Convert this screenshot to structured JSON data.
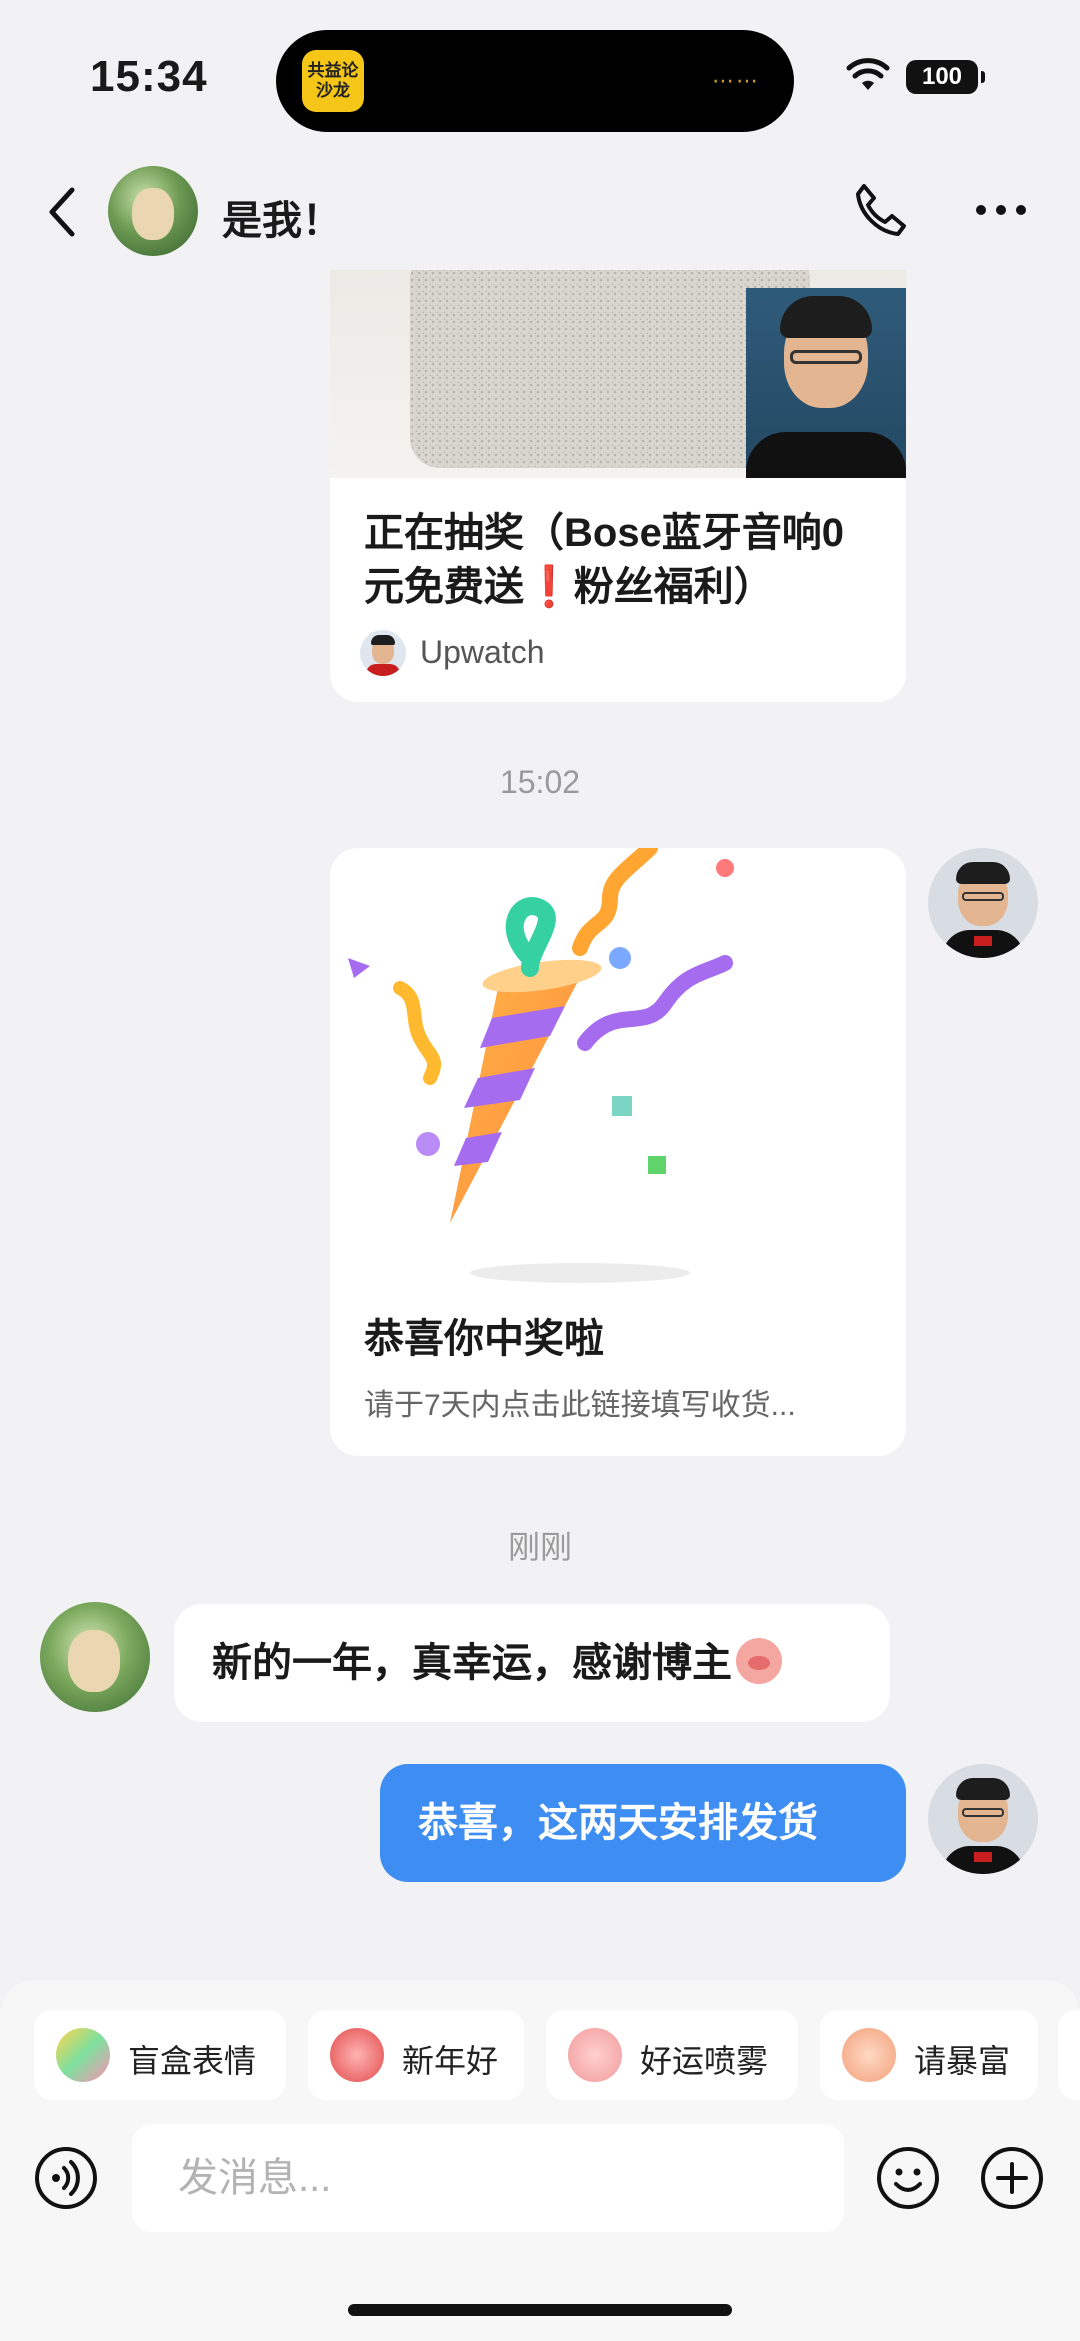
{
  "status_bar": {
    "time": "15:34",
    "island_app_label": "共益论\n沙龙",
    "battery": "100"
  },
  "header": {
    "contact_name": "是我！"
  },
  "messages": {
    "card1": {
      "title": "正在抽奖（Bose蓝牙音响0元免费送❗粉丝福利）",
      "source": "Upwatch"
    },
    "timestamp1": "15:02",
    "card2": {
      "title": "恭喜你中奖啦",
      "subtitle": "请于7天内点击此链接填写收货..."
    },
    "timestamp2": "刚刚",
    "incoming_text": "新的一年，真幸运，感谢博主",
    "outgoing_text": "恭喜，这两天安排发货"
  },
  "quick_replies": [
    {
      "label": "盲盒表情",
      "icon": "blind-box-sticker-icon"
    },
    {
      "label": "新年好",
      "icon": "new-year-sticker-icon"
    },
    {
      "label": "好运喷雾",
      "icon": "luck-spray-sticker-icon"
    },
    {
      "label": "请暴富",
      "icon": "get-rich-sticker-icon"
    }
  ],
  "composer": {
    "placeholder": "发消息..."
  },
  "colors": {
    "accent": "#3d8df2",
    "background": "#f2f2f4"
  }
}
